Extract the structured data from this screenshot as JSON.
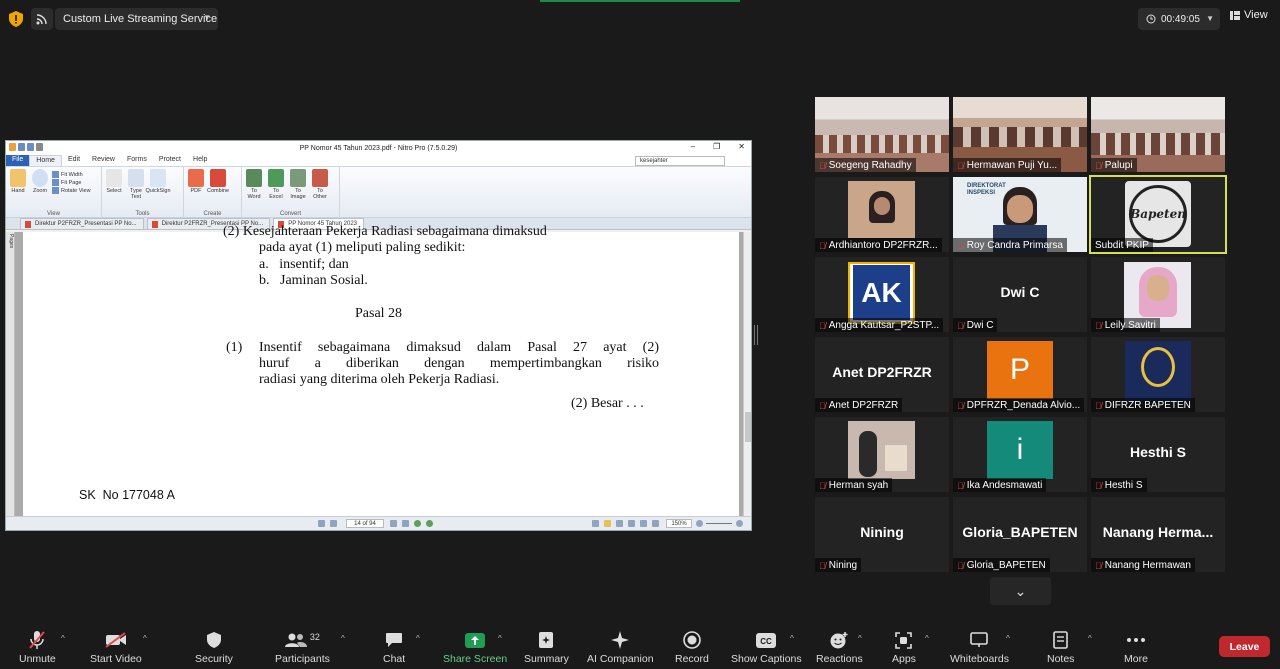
{
  "topbar": {
    "live_label": "Custom Live Streaming Service",
    "timer": "00:49:05",
    "view_label": "View"
  },
  "nitro": {
    "title": "PP Nomor 45 Tahun 2023.pdf - Nitro Pro (7.5.0.29)",
    "menu": [
      "File",
      "Home",
      "Edit",
      "Review",
      "Forms",
      "Protect",
      "Help"
    ],
    "search_value": "kesejahter",
    "ribbon": {
      "view_group": "View",
      "hand": "Hand",
      "zoom": "Zoom",
      "fit_width": "Fit Width",
      "fit_page": "Fit Page",
      "rotate_view": "Rotate View",
      "tools_group": "Tools",
      "select": "Select",
      "type_text": "Type Text",
      "quicksign": "QuickSign",
      "create_group": "Create",
      "pdf": "PDF",
      "combine": "Combine",
      "convert_group": "Convert",
      "to_word": "To Word",
      "to_excel": "To Excel",
      "to_image": "To Image",
      "to_other": "To Other"
    },
    "tabs": [
      "Direktur P2FRZR_Presentasi PP No...",
      "Direktur P2FRZR_Presentasi PP No...",
      "PP Nomor 45 Tahun 2023"
    ],
    "pages_label": "Pages",
    "doc": {
      "line0": "(2)   Kesejahteraan Pekerja Radiasi sebagaimana dimaksud",
      "line1": "pada ayat (1) meliputi paling sedikit:",
      "item_a": "a.   insentif; dan",
      "item_b": "b.   Jaminan Sosial.",
      "heading": "Pasal 28",
      "p_num": "(1)",
      "p_text_1": "Insentif sebagaimana dimaksud dalam Pasal 27 ayat (2)",
      "p_text_2": "huruf a diberikan dengan mempertimbangkan risiko",
      "p_text_3": "radiasi yang diterima oleh Pekerja Radiasi.",
      "next": "(2) Besar . . .",
      "footer": "SK  No 177048 A"
    },
    "page_indicator": "14 of 94",
    "zoom": "150%"
  },
  "gallery": [
    {
      "name": "Soegeng Rahadhy",
      "type": "photo"
    },
    {
      "name": "Hermawan Puji Yu...",
      "type": "photo"
    },
    {
      "name": "Palupi",
      "type": "photo"
    },
    {
      "name": "Ardhiantoro DP2FRZR...",
      "type": "photo"
    },
    {
      "name": "Roy Candra Primarsa",
      "type": "photo"
    },
    {
      "name": "Subdit PKIP",
      "type": "logo",
      "logo_text": "Bapeten"
    },
    {
      "name": "Angga Kautsar_P2STP...",
      "type": "logo",
      "logo_text": "AK"
    },
    {
      "name": "Dwi C",
      "type": "text",
      "big": "Dwi C"
    },
    {
      "name": "Leily Savitri",
      "type": "photo"
    },
    {
      "name": "Anet DP2FRZR",
      "type": "text",
      "big": "Anet DP2FRZR"
    },
    {
      "name": "DPFRZR_Denada Alvio...",
      "type": "letter",
      "letter": "P",
      "color": "#e8730f"
    },
    {
      "name": "DIFRZR BAPETEN",
      "type": "logo"
    },
    {
      "name": "Herman syah",
      "type": "photo"
    },
    {
      "name": "Ika Andesmawati",
      "type": "letter",
      "letter": "i",
      "color": "#138a7a"
    },
    {
      "name": "Hesthi S",
      "type": "text",
      "big": "Hesthi S"
    },
    {
      "name": "Nining",
      "type": "text",
      "big": "Nining"
    },
    {
      "name": "Gloria_BAPETEN",
      "type": "text",
      "big": "Gloria_BAPETEN"
    },
    {
      "name": "Nanang Hermawan",
      "type": "text",
      "big": "Nanang Herma..."
    }
  ],
  "toolbar": {
    "unmute": "Unmute",
    "start_video": "Start Video",
    "security": "Security",
    "participants": "Participants",
    "participants_count": "32",
    "chat": "Chat",
    "share_screen": "Share Screen",
    "summary": "Summary",
    "ai_companion": "AI Companion",
    "record": "Record",
    "show_captions": "Show Captions",
    "reactions": "Reactions",
    "apps": "Apps",
    "whiteboards": "Whiteboards",
    "notes": "Notes",
    "more": "More",
    "leave": "Leave"
  },
  "colors": {
    "leave": "#c0282d",
    "share_screen": "#1f9d55",
    "active_speaker": "#d6e04a"
  }
}
